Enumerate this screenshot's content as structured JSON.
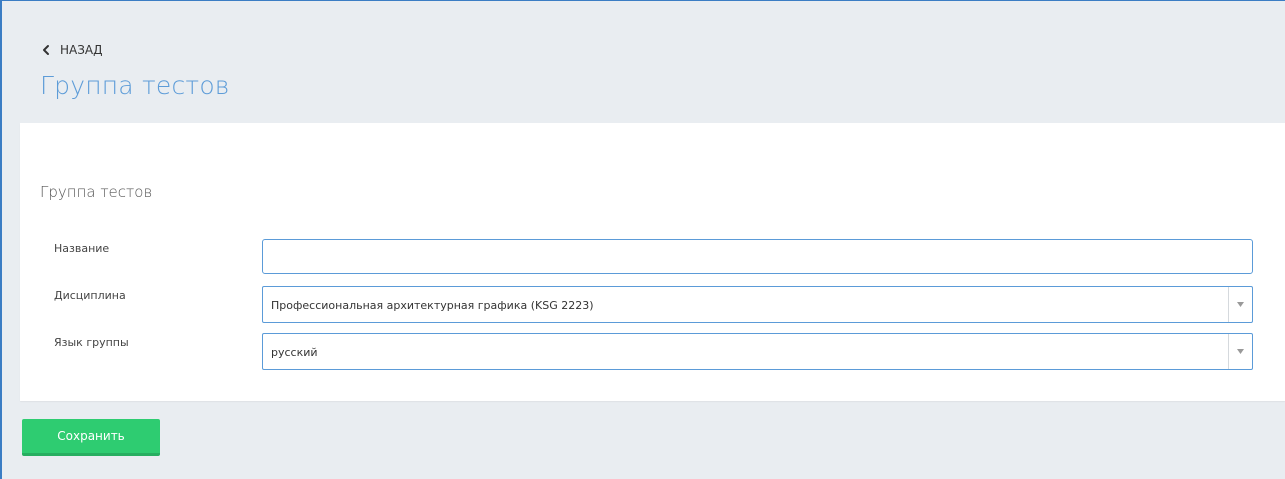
{
  "header": {
    "back_label": "НАЗАД",
    "title": "Группа тестов"
  },
  "form": {
    "section_title": "Группа тестов",
    "fields": {
      "name": {
        "label": "Название",
        "value": "",
        "placeholder": ""
      },
      "discipline": {
        "label": "Дисциплина",
        "value": "Профессиональная архитектурная графика (KSG 2223)"
      },
      "language": {
        "label": "Язык группы",
        "value": "русский"
      }
    }
  },
  "actions": {
    "save_label": "Сохранить"
  },
  "icons": {
    "back": "chevron-left-icon",
    "dropdown": "caret-down-icon"
  },
  "colors": {
    "accent": "#5d9cd8",
    "save_button": "#2ecc71",
    "background": "#e9edf1"
  }
}
